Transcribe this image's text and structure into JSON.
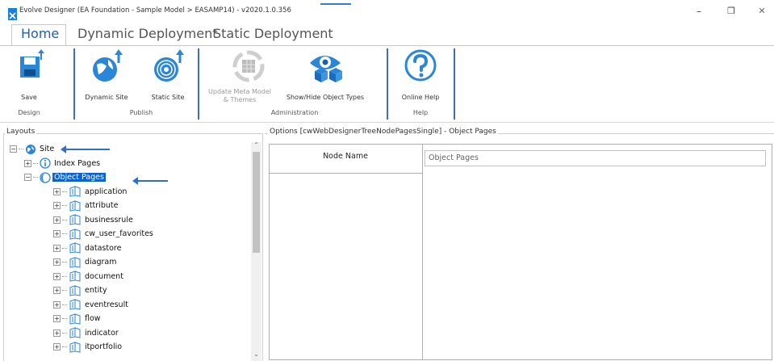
{
  "window": {
    "title": "Evolve Designer (EA Foundation - Sample Model > EASAMP14) - v2020.1.0.356",
    "minimize_glyph": "–",
    "restore_glyph": "❐",
    "close_glyph": "✕"
  },
  "tabs": [
    {
      "label": "Home",
      "active": true
    },
    {
      "label": "Dynamic Deployment",
      "active": false
    },
    {
      "label": "Static Deployment",
      "active": false
    }
  ],
  "ribbon": {
    "groups": [
      {
        "label": "Design"
      },
      {
        "label": "Publish"
      },
      {
        "label": "Administration"
      },
      {
        "label": "Help"
      }
    ],
    "buttons": {
      "save": {
        "label": "Save",
        "icon": "save-icon"
      },
      "dynamic_site": {
        "label": "Dynamic Site",
        "icon": "globe-upload-icon"
      },
      "static_site": {
        "label": "Static Site",
        "icon": "static-globe-upload-icon"
      },
      "update_meta": {
        "label": "Update Meta Model & Themes",
        "icon": "meta-model-icon",
        "disabled": true
      },
      "show_hide": {
        "label": "Show/Hide Object Types",
        "icon": "object-types-icon"
      },
      "online_help": {
        "label": "Online Help",
        "icon": "help-icon"
      }
    }
  },
  "layouts_panel": {
    "title": "Layouts",
    "tree": {
      "root": {
        "label": "Site",
        "icon": "site-globe-icon"
      },
      "index_pages": {
        "label": "Index Pages",
        "icon": "info-icon"
      },
      "object_pages": {
        "label": "Object Pages",
        "icon": "object-pages-icon",
        "selected": true
      },
      "children": [
        "application",
        "attribute",
        "businessrule",
        "cw_user_favorites",
        "datastore",
        "diagram",
        "document",
        "entity",
        "eventresult",
        "flow",
        "indicator",
        "itportfolio"
      ]
    },
    "scroll_up": "⌃",
    "scroll_down": "⌄"
  },
  "options_panel": {
    "title": "Options [cwWebDesignerTreeNodePagesSingle] - Object Pages",
    "field_label": "Node Name",
    "field_value": "Object Pages"
  },
  "colors": {
    "accent": "#1f5fb1",
    "selection": "#0a62d6",
    "separator": "#3d6ec5",
    "arrow": "#2f6fc9"
  }
}
